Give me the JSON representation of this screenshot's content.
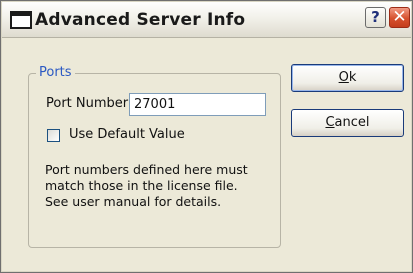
{
  "window": {
    "title": "Advanced Server Info",
    "help_glyph": "?",
    "close_glyph": "✕"
  },
  "ports_group": {
    "label": "Ports",
    "port_number_label": "Port Number",
    "port_number_value": "27001",
    "use_default_label": "Use Default Value",
    "use_default_checked": false,
    "note_lines": [
      "Port numbers defined here must",
      "match those in the license file.",
      "See user manual for details."
    ]
  },
  "buttons": {
    "ok": {
      "mnemonic": "O",
      "rest": "k"
    },
    "cancel": {
      "mnemonic": "C",
      "rest": "ancel"
    }
  },
  "colors": {
    "dialog_bg": "#ece9d8",
    "group_label": "#2b59c3",
    "close_button": "#d6502e",
    "button_border": "#1a3b7a"
  },
  "icons": [
    "window-icon",
    "help-icon",
    "close-icon"
  ]
}
